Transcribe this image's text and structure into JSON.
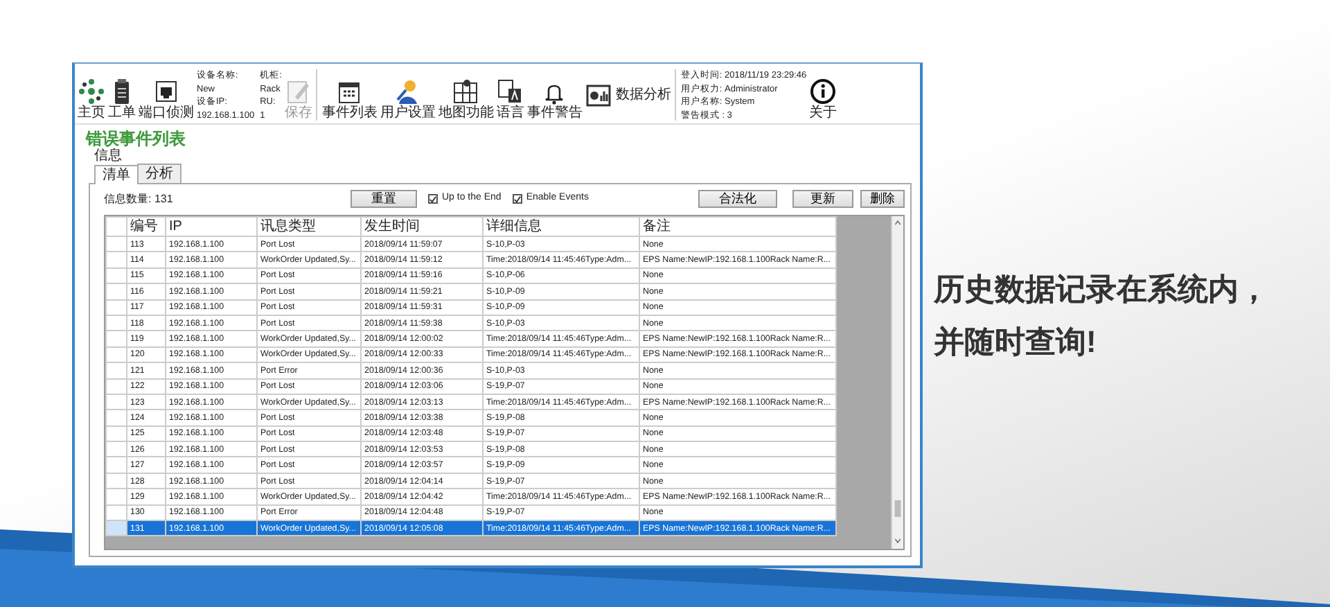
{
  "toolbar": [
    {
      "kind": "button",
      "label": "主页",
      "disabled": false
    },
    {
      "kind": "button",
      "label": "工单",
      "disabled": false
    },
    {
      "kind": "button",
      "label": "端口侦测",
      "disabled": false
    },
    {
      "kind": "info",
      "columns": [
        [
          "设备名称:",
          "New",
          "设备IP:",
          "192.168.1.100"
        ],
        [
          "机柜:",
          "Rack",
          "RU:",
          "1"
        ]
      ]
    },
    {
      "kind": "button",
      "label": "保存",
      "disabled": true
    },
    {
      "kind": "separator"
    },
    {
      "kind": "button",
      "label": "事件列表",
      "disabled": false
    },
    {
      "kind": "button",
      "label": "用户设置",
      "disabled": false
    },
    {
      "kind": "button",
      "label": "地图功能",
      "disabled": false
    },
    {
      "kind": "button",
      "label": "语言",
      "disabled": false
    },
    {
      "kind": "button",
      "label": "事件警告",
      "disabled": false
    },
    {
      "kind": "button",
      "label": "数据分析",
      "disabled": false,
      "side": true
    },
    {
      "kind": "info",
      "columns": [
        [
          "登入时间: 2018/11/19 23:29:46",
          "用户权力: Administrator",
          "用户名称: System",
          "警告模式 : 3"
        ]
      ]
    },
    {
      "kind": "button",
      "label": "关于",
      "disabled": false
    }
  ],
  "page_title": "错误事件列表",
  "group_label": "信息",
  "tabs": [
    {
      "label": "清单",
      "selected": true
    },
    {
      "label": "分析",
      "selected": false
    }
  ],
  "count_label": "信息数量: 131",
  "reset_button": "重置",
  "checkboxes": [
    {
      "label": "Up to the End",
      "checked": true
    },
    {
      "label": "Enable Events",
      "checked": true
    }
  ],
  "action_buttons": [
    "合法化",
    "更新",
    "删除"
  ],
  "table": {
    "columns": [
      "编号",
      "IP",
      "讯息类型",
      "发生时间",
      "详细信息",
      "备注"
    ],
    "rows": [
      {
        "selected": false,
        "cells": [
          "113",
          "192.168.1.100",
          "Port Lost",
          "2018/09/14 11:59:07",
          "S-10,P-03",
          "None"
        ]
      },
      {
        "selected": false,
        "cells": [
          "114",
          "192.168.1.100",
          "WorkOrder Updated,Sy...",
          "2018/09/14 11:59:12",
          "Time:2018/09/14 11:45:46Type:Adm...",
          "EPS Name:NewIP:192.168.1.100Rack Name:R..."
        ]
      },
      {
        "selected": false,
        "cells": [
          "115",
          "192.168.1.100",
          "Port Lost",
          "2018/09/14 11:59:16",
          "S-10,P-06",
          "None"
        ]
      },
      {
        "selected": false,
        "cells": [
          "116",
          "192.168.1.100",
          "Port Lost",
          "2018/09/14 11:59:21",
          "S-10,P-09",
          "None"
        ]
      },
      {
        "selected": false,
        "cells": [
          "117",
          "192.168.1.100",
          "Port Lost",
          "2018/09/14 11:59:31",
          "S-10,P-09",
          "None"
        ]
      },
      {
        "selected": false,
        "cells": [
          "118",
          "192.168.1.100",
          "Port Lost",
          "2018/09/14 11:59:38",
          "S-10,P-03",
          "None"
        ]
      },
      {
        "selected": false,
        "cells": [
          "119",
          "192.168.1.100",
          "WorkOrder Updated,Sy...",
          "2018/09/14 12:00:02",
          "Time:2018/09/14 11:45:46Type:Adm...",
          "EPS Name:NewIP:192.168.1.100Rack Name:R..."
        ]
      },
      {
        "selected": false,
        "cells": [
          "120",
          "192.168.1.100",
          "WorkOrder Updated,Sy...",
          "2018/09/14 12:00:33",
          "Time:2018/09/14 11:45:46Type:Adm...",
          "EPS Name:NewIP:192.168.1.100Rack Name:R..."
        ]
      },
      {
        "selected": false,
        "cells": [
          "121",
          "192.168.1.100",
          "Port Error",
          "2018/09/14 12:00:36",
          "S-10,P-03",
          "None"
        ]
      },
      {
        "selected": false,
        "cells": [
          "122",
          "192.168.1.100",
          "Port Lost",
          "2018/09/14 12:03:06",
          "S-19,P-07",
          "None"
        ]
      },
      {
        "selected": false,
        "cells": [
          "123",
          "192.168.1.100",
          "WorkOrder Updated,Sy...",
          "2018/09/14 12:03:13",
          "Time:2018/09/14 11:45:46Type:Adm...",
          "EPS Name:NewIP:192.168.1.100Rack Name:R..."
        ]
      },
      {
        "selected": false,
        "cells": [
          "124",
          "192.168.1.100",
          "Port Lost",
          "2018/09/14 12:03:38",
          "S-19,P-08",
          "None"
        ]
      },
      {
        "selected": false,
        "cells": [
          "125",
          "192.168.1.100",
          "Port Lost",
          "2018/09/14 12:03:48",
          "S-19,P-07",
          "None"
        ]
      },
      {
        "selected": false,
        "cells": [
          "126",
          "192.168.1.100",
          "Port Lost",
          "2018/09/14 12:03:53",
          "S-19,P-08",
          "None"
        ]
      },
      {
        "selected": false,
        "cells": [
          "127",
          "192.168.1.100",
          "Port Lost",
          "2018/09/14 12:03:57",
          "S-19,P-09",
          "None"
        ]
      },
      {
        "selected": false,
        "cells": [
          "128",
          "192.168.1.100",
          "Port Lost",
          "2018/09/14 12:04:14",
          "S-19,P-07",
          "None"
        ]
      },
      {
        "selected": false,
        "cells": [
          "129",
          "192.168.1.100",
          "WorkOrder Updated,Sy...",
          "2018/09/14 12:04:42",
          "Time:2018/09/14 11:45:46Type:Adm...",
          "EPS Name:NewIP:192.168.1.100Rack Name:R..."
        ]
      },
      {
        "selected": false,
        "cells": [
          "130",
          "192.168.1.100",
          "Port Error",
          "2018/09/14 12:04:48",
          "S-19,P-07",
          "None"
        ]
      },
      {
        "selected": true,
        "cells": [
          "131",
          "192.168.1.100",
          "WorkOrder Updated,Sy...",
          "2018/09/14 12:05:08",
          "Time:2018/09/14 11:45:46Type:Adm...",
          "EPS Name:NewIP:192.168.1.100Rack Name:R..."
        ]
      }
    ]
  },
  "slogan": [
    "历史数据记录在系统内，",
    "并随时查询!"
  ]
}
